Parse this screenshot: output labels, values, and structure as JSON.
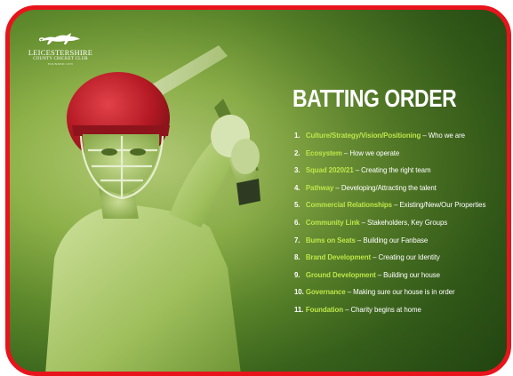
{
  "logo": {
    "line1": "LEICESTERSHIRE",
    "line2": "COUNTY CRICKET CLUB",
    "line3": "FOUNDED 1879"
  },
  "title": "BATTING ORDER",
  "items": [
    {
      "num": "1.",
      "highlight": "Culture/Strategy/Vision/Positioning",
      "desc": " – Who we are"
    },
    {
      "num": "2.",
      "highlight": "Ecosystem",
      "desc": " – How we operate"
    },
    {
      "num": "3.",
      "highlight": "Squad 2020/21",
      "desc": " – Creating the right team"
    },
    {
      "num": "4.",
      "highlight": "Pathway",
      "desc": " – Developing/Attracting the talent"
    },
    {
      "num": "5.",
      "highlight": "Commercial Relationships",
      "desc": " – Existing/New/Our Properties"
    },
    {
      "num": "6.",
      "highlight": "Community Link",
      "desc": " – Stakeholders, Key Groups"
    },
    {
      "num": "7.",
      "highlight": "Bums on Seats",
      "desc": " – Building our Fanbase"
    },
    {
      "num": "8.",
      "highlight": "Brand Development",
      "desc": " – Creating our Identity"
    },
    {
      "num": "9.",
      "highlight": "Ground Development",
      "desc": " – Building our house"
    },
    {
      "num": "10.",
      "highlight": "Governance",
      "desc": " – Making sure our house is in order"
    },
    {
      "num": "11.",
      "highlight": "Foundation",
      "desc": " – Charity begins at home"
    }
  ],
  "colors": {
    "frame_border": "#e8141c",
    "highlight": "#bde64a",
    "text": "#ffffff",
    "background": "#4f7a25",
    "helmet": "#c0202a"
  },
  "icons": [
    "fox-logo-icon",
    "cricketer-illustration"
  ]
}
